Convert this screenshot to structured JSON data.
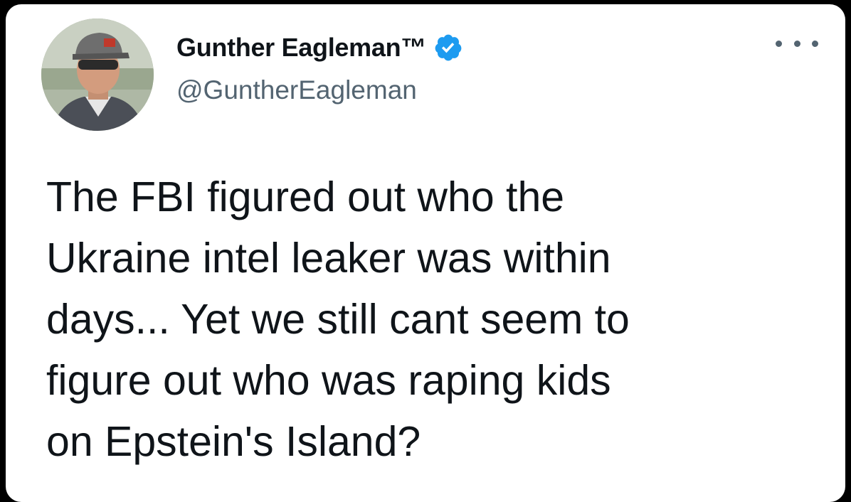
{
  "tweet": {
    "author": {
      "display_name": "Gunther Eagleman™",
      "handle": "@GuntherEagleman",
      "verified": true,
      "verified_color": "#1d9bf0",
      "avatar_icon": "profile-photo"
    },
    "more_icon": "ellipsis-icon",
    "text": "The FBI figured out who the\nUkraine intel leaker was within\ndays...  Yet we still cant seem to\nfigure out who was raping kids\non Epstein's Island?"
  }
}
